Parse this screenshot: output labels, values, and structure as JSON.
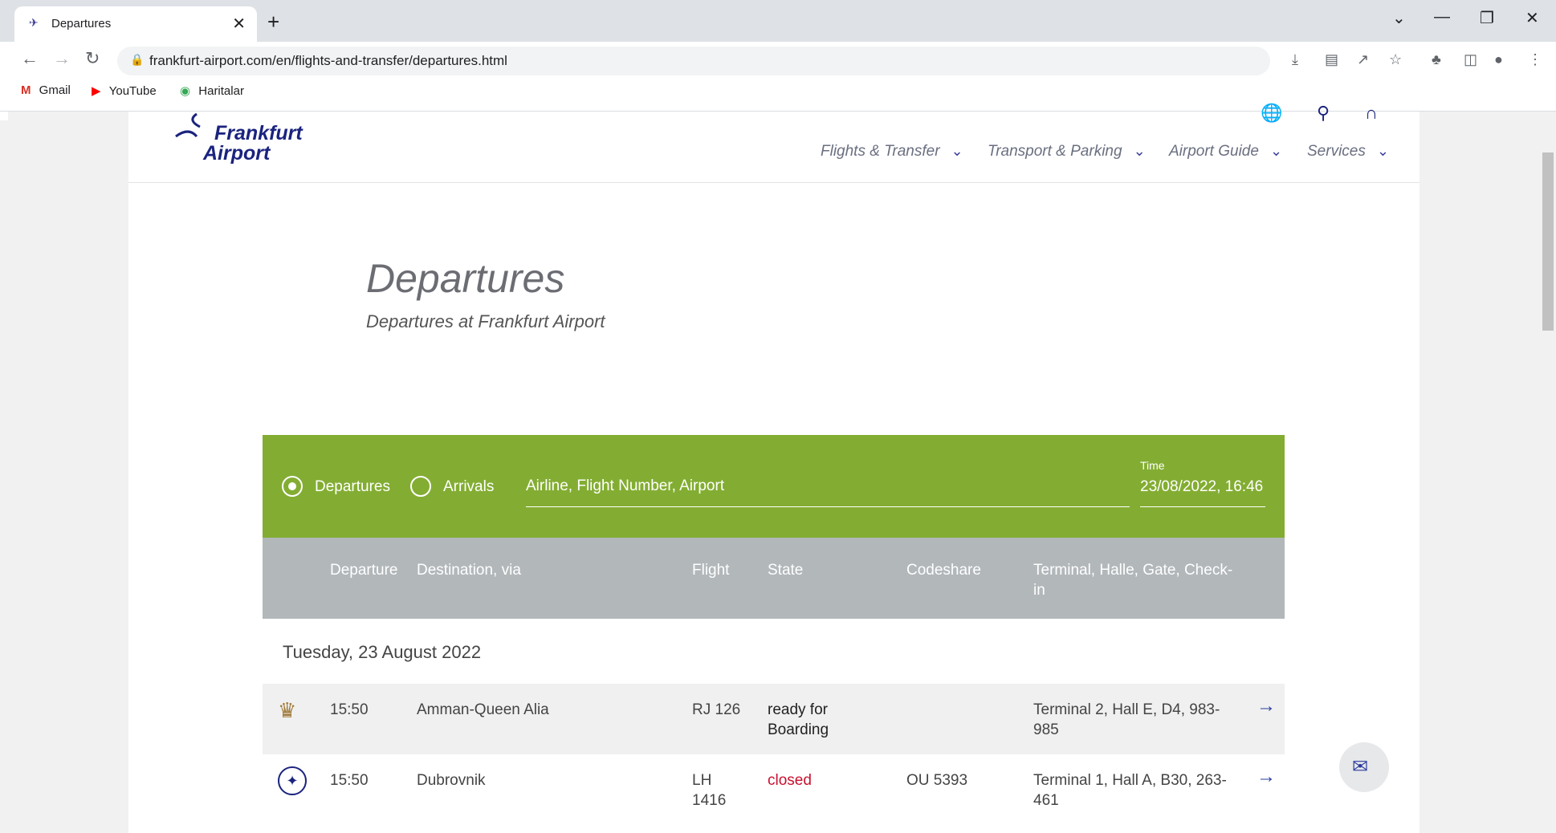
{
  "browser": {
    "tab_title": "Departures",
    "new_tab": "+",
    "url": "frankfurt-airport.com/en/flights-and-transfer/departures.html",
    "bookmarks": [
      {
        "label": "Gmail",
        "icon": "gmail-icon"
      },
      {
        "label": "YouTube",
        "icon": "youtube-icon"
      },
      {
        "label": "Haritalar",
        "icon": "maps-icon"
      }
    ]
  },
  "site": {
    "logo_line1": "Frankfurt",
    "logo_line2": "Airport",
    "nav": [
      "Flights & Transfer",
      "Transport & Parking",
      "Airport Guide",
      "Services"
    ]
  },
  "page": {
    "title": "Departures",
    "subtitle": "Departures at Frankfurt Airport"
  },
  "filter": {
    "radio_departures": "Departures",
    "radio_arrivals": "Arrivals",
    "selected": "Departures",
    "search_placeholder": "Airline, Flight Number, Airport",
    "time_label": "Time",
    "time_value": "23/08/2022, 16:46"
  },
  "table": {
    "headers": [
      "Departure",
      "Destination, via",
      "Flight",
      "State",
      "Codeshare",
      "Terminal, Halle, Gate, Check-in"
    ],
    "date": "Tuesday, 23 August 2022",
    "rows": [
      {
        "airline_icon": "royal-jordanian-crown-icon",
        "time": "15:50",
        "destination": "Amman-Queen Alia",
        "flight": "RJ 126",
        "state": "ready for Boarding",
        "codeshare": "",
        "terminal": "Terminal 2, Hall E, D4, 983-985"
      },
      {
        "airline_icon": "lufthansa-crane-icon",
        "time": "15:50",
        "destination": "Dubrovnik",
        "flight": "LH 1416",
        "state": "closed",
        "codeshare": "OU 5393",
        "terminal": "Terminal 1, Hall A, B30, 263-461"
      }
    ]
  }
}
